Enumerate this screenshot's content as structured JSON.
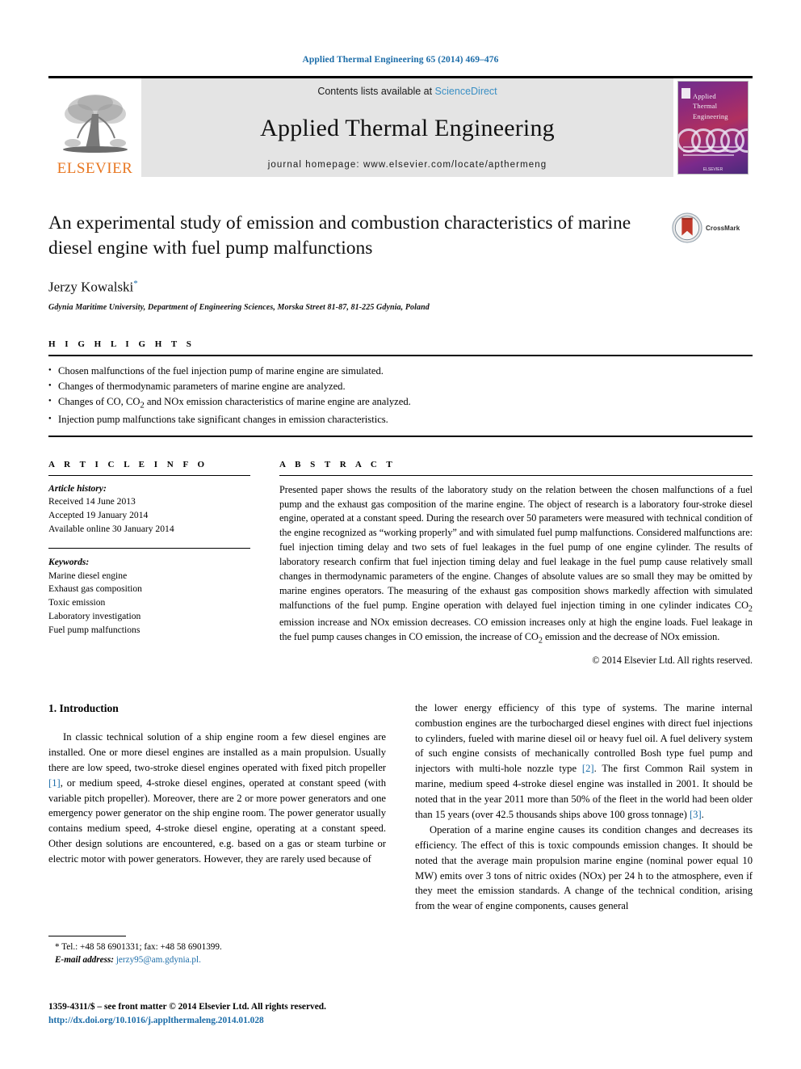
{
  "running_head": "Applied Thermal Engineering 65 (2014) 469–476",
  "masthead": {
    "contents_prefix": "Contents lists available at ",
    "sciencedirect": "ScienceDirect",
    "journal_title": "Applied Thermal Engineering",
    "homepage": "journal homepage: www.elsevier.com/locate/apthermeng",
    "publisher": "ELSEVIER",
    "cover_title_lines": [
      "Applied",
      "Thermal",
      "Engineering"
    ],
    "cover_brand": "ELSEVIER",
    "colors": {
      "link": "#3a8fc4",
      "elsevier_orange": "#E87722",
      "masthead_bg": "#e4e4e4"
    }
  },
  "article": {
    "title": "An experimental study of emission and combustion characteristics of marine diesel engine with fuel pump malfunctions",
    "crossmark_label": "CrossMark",
    "author": "Jerzy Kowalski",
    "author_marker": "*",
    "affiliation": "Gdynia Maritime University, Department of Engineering Sciences, Morska Street 81-87, 81-225 Gdynia, Poland"
  },
  "highlights": {
    "heading": "H I G H L I G H T S",
    "items": [
      "Chosen malfunctions of the fuel injection pump of marine engine are simulated.",
      "Changes of thermodynamic parameters of marine engine are analyzed.",
      "Changes of CO, CO2 and NOx emission characteristics of marine engine are analyzed.",
      "Injection pump malfunctions take significant changes in emission characteristics."
    ]
  },
  "article_info": {
    "heading": "A R T I C L E   I N F O",
    "history_label": "Article history:",
    "history": [
      "Received 14 June 2013",
      "Accepted 19 January 2014",
      "Available online 30 January 2014"
    ],
    "keywords_label": "Keywords:",
    "keywords": [
      "Marine diesel engine",
      "Exhaust gas composition",
      "Toxic emission",
      "Laboratory investigation",
      "Fuel pump malfunctions"
    ]
  },
  "abstract": {
    "heading": "A B S T R A C T",
    "text": "Presented paper shows the results of the laboratory study on the relation between the chosen malfunctions of a fuel pump and the exhaust gas composition of the marine engine. The object of research is a laboratory four-stroke diesel engine, operated at a constant speed. During the research over 50 parameters were measured with technical condition of the engine recognized as “working properly” and with simulated fuel pump malfunctions. Considered malfunctions are: fuel injection timing delay and two sets of fuel leakages in the fuel pump of one engine cylinder. The results of laboratory research confirm that fuel injection timing delay and fuel leakage in the fuel pump cause relatively small changes in thermodynamic parameters of the engine. Changes of absolute values are so small they may be omitted by marine engines operators. The measuring of the exhaust gas composition shows markedly affection with simulated malfunctions of the fuel pump. Engine operation with delayed fuel injection timing in one cylinder indicates CO2 emission increase and NOx emission decreases. CO emission increases only at high the engine loads. Fuel leakage in the fuel pump causes changes in CO emission, the increase of CO2 emission and the decrease of NOx emission.",
    "copyright": "© 2014 Elsevier Ltd. All rights reserved."
  },
  "body": {
    "section_number_title": "1. Introduction",
    "left_paragraphs": [
      "In classic technical solution of a ship engine room a few diesel engines are installed. One or more diesel engines are installed as a main propulsion. Usually there are low speed, two-stroke diesel engines operated with fixed pitch propeller [1], or medium speed, 4-stroke diesel engines, operated at constant speed (with variable pitch propeller). Moreover, there are 2 or more power generators and one emergency power generator on the ship engine room. The power generator usually contains medium speed, 4-stroke diesel engine, operating at a constant speed. Other design solutions are encountered, e.g. based on a gas or steam turbine or electric motor with power generators. However, they are rarely used because of"
    ],
    "right_paragraphs": [
      "the lower energy efficiency of this type of systems. The marine internal combustion engines are the turbocharged diesel engines with direct fuel injections to cylinders, fueled with marine diesel oil or heavy fuel oil. A fuel delivery system of such engine consists of mechanically controlled Bosh type fuel pump and injectors with multi-hole nozzle type [2]. The first Common Rail system in marine, medium speed 4-stroke diesel engine was installed in 2001. It should be noted that in the year 2011 more than 50% of the fleet in the world had been older than 15 years (over 42.5 thousands ships above 100 gross tonnage) [3].",
      "Operation of a marine engine causes its condition changes and decreases its efficiency. The effect of this is toxic compounds emission changes. It should be noted that the average main propulsion marine engine (nominal power equal 10 MW) emits over 3 tons of nitric oxides (NOx) per 24 h to the atmosphere, even if they meet the emission standards. A change of the technical condition, arising from the wear of engine components, causes general"
    ]
  },
  "footnote": {
    "tel_line": "* Tel.: +48 58 6901331; fax: +48 58 6901399.",
    "email_label": "E-mail address:",
    "email": "jerzy95@am.gdynia.pl."
  },
  "footer": {
    "issn_line": "1359-4311/$ – see front matter © 2014 Elsevier Ltd. All rights reserved.",
    "doi": "http://dx.doi.org/10.1016/j.applthermaleng.2014.01.028"
  }
}
